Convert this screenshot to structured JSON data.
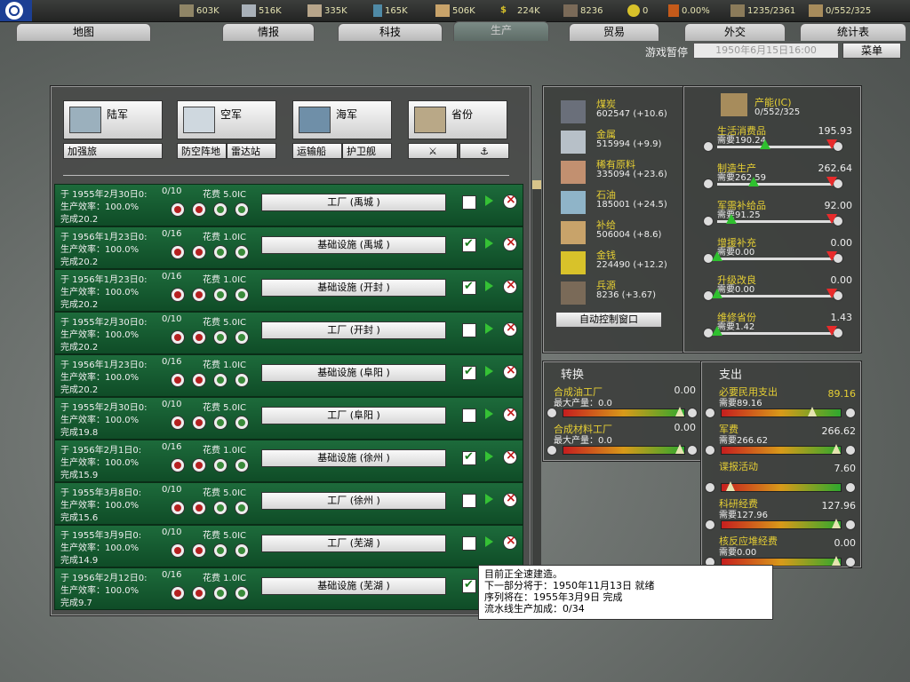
{
  "topbar": {
    "resources": [
      {
        "icon": "energy-coal-icon",
        "value": "603K"
      },
      {
        "icon": "metal-icon",
        "value": "516K"
      },
      {
        "icon": "rare-materials-icon",
        "value": "335K"
      },
      {
        "icon": "oil-icon",
        "value": "165K"
      },
      {
        "icon": "supplies-icon",
        "value": "506K"
      },
      {
        "icon": "money-icon",
        "value": "224K"
      },
      {
        "icon": "manpower-icon",
        "value": "8236"
      },
      {
        "icon": "nuclear-icon",
        "value": "0"
      },
      {
        "icon": "dissent-icon",
        "value": "0.00%"
      },
      {
        "icon": "transport-icon",
        "value": "1235/2361"
      },
      {
        "icon": "ic-icon",
        "value": "0/552/325"
      }
    ]
  },
  "tabs": [
    {
      "label": "地图"
    },
    {
      "label": "情报"
    },
    {
      "label": "科技"
    },
    {
      "label": "生产"
    },
    {
      "label": "贸易"
    },
    {
      "label": "外交"
    },
    {
      "label": "统计表"
    }
  ],
  "status": {
    "paused": "游戏暂停",
    "date": "1950年6月15日16:00",
    "menu": "菜单"
  },
  "production": {
    "unit_buttons": [
      {
        "label": "陆军"
      },
      {
        "label": "空军"
      },
      {
        "label": "海军"
      },
      {
        "label": "省份"
      }
    ],
    "sub_buttons": [
      "加强旅",
      "防空阵地",
      "雷达站",
      "运输船",
      "护卫舰"
    ],
    "rows": [
      {
        "t1": "于 1955年2月30日0:",
        "cnt": "0/10",
        "fee": "花费 5.0IC",
        "t2": "生产效率：100.0%",
        "t3": "完成20.2",
        "name": "工厂  (禹城 )",
        "checked": false
      },
      {
        "t1": "于 1956年1月23日0:",
        "cnt": "0/16",
        "fee": "花费 1.0IC",
        "t2": "生产效率：100.0%",
        "t3": "完成20.2",
        "name": "基础设施  (禹城 )",
        "checked": true
      },
      {
        "t1": "于 1956年1月23日0:",
        "cnt": "0/16",
        "fee": "花费 1.0IC",
        "t2": "生产效率：100.0%",
        "t3": "完成20.2",
        "name": "基础设施  (开封 )",
        "checked": true
      },
      {
        "t1": "于 1955年2月30日0:",
        "cnt": "0/10",
        "fee": "花费 5.0IC",
        "t2": "生产效率：100.0%",
        "t3": "完成20.2",
        "name": "工厂  (开封 )",
        "checked": false
      },
      {
        "t1": "于 1956年1月23日0:",
        "cnt": "0/16",
        "fee": "花费 1.0IC",
        "t2": "生产效率：100.0%",
        "t3": "完成20.2",
        "name": "基础设施  (阜阳 )",
        "checked": true
      },
      {
        "t1": "于 1955年2月30日0:",
        "cnt": "0/10",
        "fee": "花费 5.0IC",
        "t2": "生产效率：100.0%",
        "t3": "完成19.8",
        "name": "工厂  (阜阳 )",
        "checked": false
      },
      {
        "t1": "于 1956年2月1日0:",
        "cnt": "0/16",
        "fee": "花费 1.0IC",
        "t2": "生产效率：100.0%",
        "t3": "完成15.9",
        "name": "基础设施  (徐州 )",
        "checked": true
      },
      {
        "t1": "于 1955年3月8日0:",
        "cnt": "0/10",
        "fee": "花费 5.0IC",
        "t2": "生产效率：100.0%",
        "t3": "完成15.6",
        "name": "工厂  (徐州 )",
        "checked": false
      },
      {
        "t1": "于 1955年3月9日0:",
        "cnt": "0/10",
        "fee": "花费 5.0IC",
        "t2": "生产效率：100.0%",
        "t3": "完成14.9",
        "name": "工厂  (芜湖 )",
        "checked": false
      },
      {
        "t1": "于 1956年2月12日0:",
        "cnt": "0/16",
        "fee": "花费 1.0IC",
        "t2": "生产效率：100.0%",
        "t3": "完成9.7",
        "name": "基础设施  (芜湖 )",
        "checked": true
      }
    ]
  },
  "stockpile": [
    {
      "name": "煤炭",
      "value": "602547 (+10.6)",
      "icon": "coal-icon"
    },
    {
      "name": "金属",
      "value": "515994 (+9.9)",
      "icon": "metal-icon"
    },
    {
      "name": "稀有原料",
      "value": "335094 (+23.6)",
      "icon": "rare-materials-icon"
    },
    {
      "name": "石油",
      "value": "185001 (+24.5)",
      "icon": "oil-icon"
    },
    {
      "name": "补给",
      "value": "506004 (+8.6)",
      "icon": "supplies-icon"
    },
    {
      "name": "金钱",
      "value": "224490 (+12.2)",
      "icon": "money-icon"
    },
    {
      "name": "兵源",
      "value": "8236 (+3.67)",
      "icon": "manpower-icon"
    }
  ],
  "auto_control": "自动控制窗口",
  "ic": {
    "title": "产能(IC)",
    "value": "0/552/325",
    "sliders": [
      {
        "name": "生活消费品",
        "need": "需要190.24",
        "value": "195.93",
        "g": 0.4,
        "r": 0.95
      },
      {
        "name": "制造生产",
        "need": "需要262.59",
        "value": "262.64",
        "g": 0.3,
        "r": 0.95
      },
      {
        "name": "军需补给品",
        "need": "需要91.25",
        "value": "92.00",
        "g": 0.12,
        "r": 0.95
      },
      {
        "name": "增援补充",
        "need": "需要0.00",
        "value": "0.00",
        "g": 0.0,
        "r": 0.95
      },
      {
        "name": "升级改良",
        "need": "需要0.00",
        "value": "0.00",
        "g": 0.0,
        "r": 0.95
      },
      {
        "name": "维修省份",
        "need": "需要1.42",
        "value": "1.43",
        "g": 0.0,
        "r": 0.95
      }
    ]
  },
  "conversion": {
    "title": "转换",
    "items": [
      {
        "name": "合成油工厂",
        "max": "最大产量：0.0",
        "value": "0.00"
      },
      {
        "name": "合成材料工厂",
        "max": "最大产量：0.0",
        "value": "0.00"
      }
    ]
  },
  "spending": {
    "title": "支出",
    "items": [
      {
        "name": "必要民用支出",
        "need": "需要89.16",
        "value": "89.16",
        "pos": 0.78
      },
      {
        "name": "军费",
        "need": "需要266.62",
        "value": "266.62",
        "pos": 1.0
      },
      {
        "name": "谍报活动",
        "need": "",
        "value": "7.60",
        "pos": 0.04
      },
      {
        "name": "科研经费",
        "need": "需要127.96",
        "value": "127.96",
        "pos": 1.0
      },
      {
        "name": "核反应堆经费",
        "need": "需要0.00",
        "value": "0.00",
        "pos": 1.0
      }
    ]
  },
  "tooltip": {
    "lines": [
      "目前正全速建造。",
      "下一部分将于：1950年11月13日 就绪",
      "序列将在：1955年3月9日 完成",
      "流水线生产加成：0/34"
    ]
  },
  "colors": {
    "row_green": "#1d6b3b",
    "label_yellow": "#e6cf34",
    "accent_red": "#e82b2b",
    "accent_green": "#2fc02f"
  }
}
